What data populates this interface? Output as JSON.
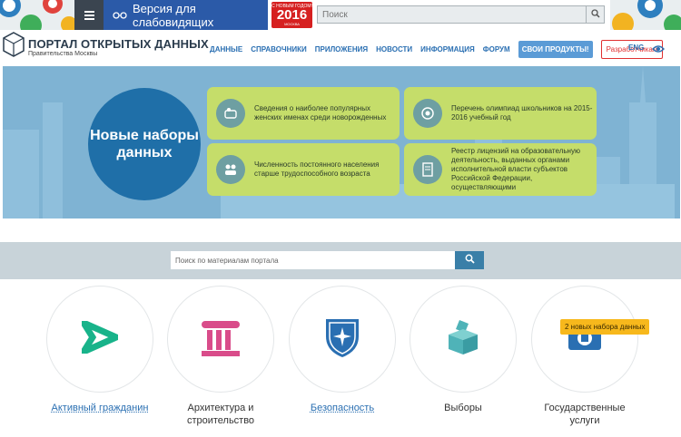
{
  "topbar": {
    "vision_label": "Версия для слабовидящих",
    "ny_top": "С НОВЫМ ГОДОМ!",
    "ny_year": "2016",
    "ny_city": "МОСКВА",
    "search_placeholder": "Поиск"
  },
  "header": {
    "logo_title": "ПОРТАЛ ОТКРЫТЫХ ДАННЫХ",
    "logo_subtitle": "Правительства Москвы",
    "nav": [
      "ДАННЫЕ",
      "СПРАВОЧНИКИ",
      "ПРИЛОЖЕНИЯ",
      "НОВОСТИ",
      "ИНФОРМАЦИЯ",
      "ФОРУМ"
    ],
    "products_label": "СВОИ ПРОДУКТЫ!",
    "developers_label": "Разработчикам",
    "lang": "ENG"
  },
  "hero": {
    "circle_text": "Новые наборы данных",
    "cards": [
      "Сведения о наиболее популярных женских именах среди новорожденных",
      "Перечень олимпиад школьников на 2015-2016 учебный год",
      "Численность постоянного населения старше трудоспособного возраста",
      "Реестр лицензий на образовательную деятельность, выданных органами исполнительной власти субъектов Российской Федерации, осуществляющими"
    ]
  },
  "portal_search": {
    "placeholder": "Поиск по материалам портала"
  },
  "categories": [
    {
      "label": "Активный гражданин",
      "icon": "active-citizen-icon"
    },
    {
      "label": "Архитектура и строительство",
      "icon": "column-icon"
    },
    {
      "label": "Безопасность",
      "icon": "shield-icon"
    },
    {
      "label": "Выборы",
      "icon": "ballot-box-icon"
    },
    {
      "label": "Государственные услуги",
      "icon": "coat-of-arms-icon"
    }
  ],
  "badge": "2 новых набора данных",
  "colors": {
    "accent": "#2a6fb2",
    "hero_bg": "#7fb3d3",
    "card": "#c5dd6a",
    "circle": "#1f6fa8",
    "vision": "#2b5aa8"
  }
}
